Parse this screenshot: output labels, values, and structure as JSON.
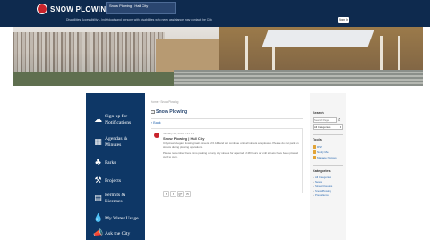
{
  "header": {
    "site_title": "SNOW PLOWING",
    "tab_label": "Snow Plowing | Hall City",
    "notice": "Disabilities Accessibility – Individuals and persons with disabilities who need assistance may contact the City.",
    "signin_label": "Sign In"
  },
  "sidebar": {
    "items": [
      {
        "label_line1": "Sign up for",
        "label_line2": "Notifications",
        "icon": "cloud-icon"
      },
      {
        "label_line1": "Agendas &",
        "label_line2": "Minutes",
        "icon": "calendar-icon"
      },
      {
        "label_line1": "Parks",
        "label_line2": "",
        "icon": "park-icon"
      },
      {
        "label_line1": "Projects",
        "label_line2": "",
        "icon": "projects-icon"
      },
      {
        "label_line1": "Permits &",
        "label_line2": "Licenses",
        "icon": "permit-icon"
      },
      {
        "label_line1": "My Water Usage",
        "label_line2": "",
        "icon": "water-drop-icon"
      },
      {
        "label_line1": "Ask the City",
        "label_line2": "",
        "icon": "megaphone-icon"
      }
    ]
  },
  "main": {
    "breadcrumb": "Home › Snow Plowing",
    "page_title": "Snow Plowing",
    "back_link": "« Back",
    "post": {
      "date": "January 22, 2016 5:31 PM",
      "title": "Snow Plowing | Hall City",
      "body_1": "City crews began plowing main streets of 6 AM and will continue until all streets are plowed. Please do not park on streets during plowing operations.",
      "body_2": "Please remember there is no parking on any city streets for a period of 48 hours or until streets have been plowed curb to curb."
    },
    "share_buttons": [
      "f",
      "t",
      "g+",
      "✉"
    ]
  },
  "right_col": {
    "search_heading": "Search",
    "search_placeholder": "Search Page",
    "category_select": "All Categories",
    "tools_heading": "Tools",
    "tools": [
      "RSS",
      "Notify Me",
      "Manage Notices"
    ],
    "categories_heading": "Categories",
    "categories": [
      "All Categories",
      "News",
      "Street Closures",
      "Snow Plowing",
      "Press Items"
    ]
  },
  "colors": {
    "topbar": "#0e2a4e",
    "sidebar": "#0e3766",
    "brand_red": "#c8232c",
    "link": "#2c6ab1"
  }
}
